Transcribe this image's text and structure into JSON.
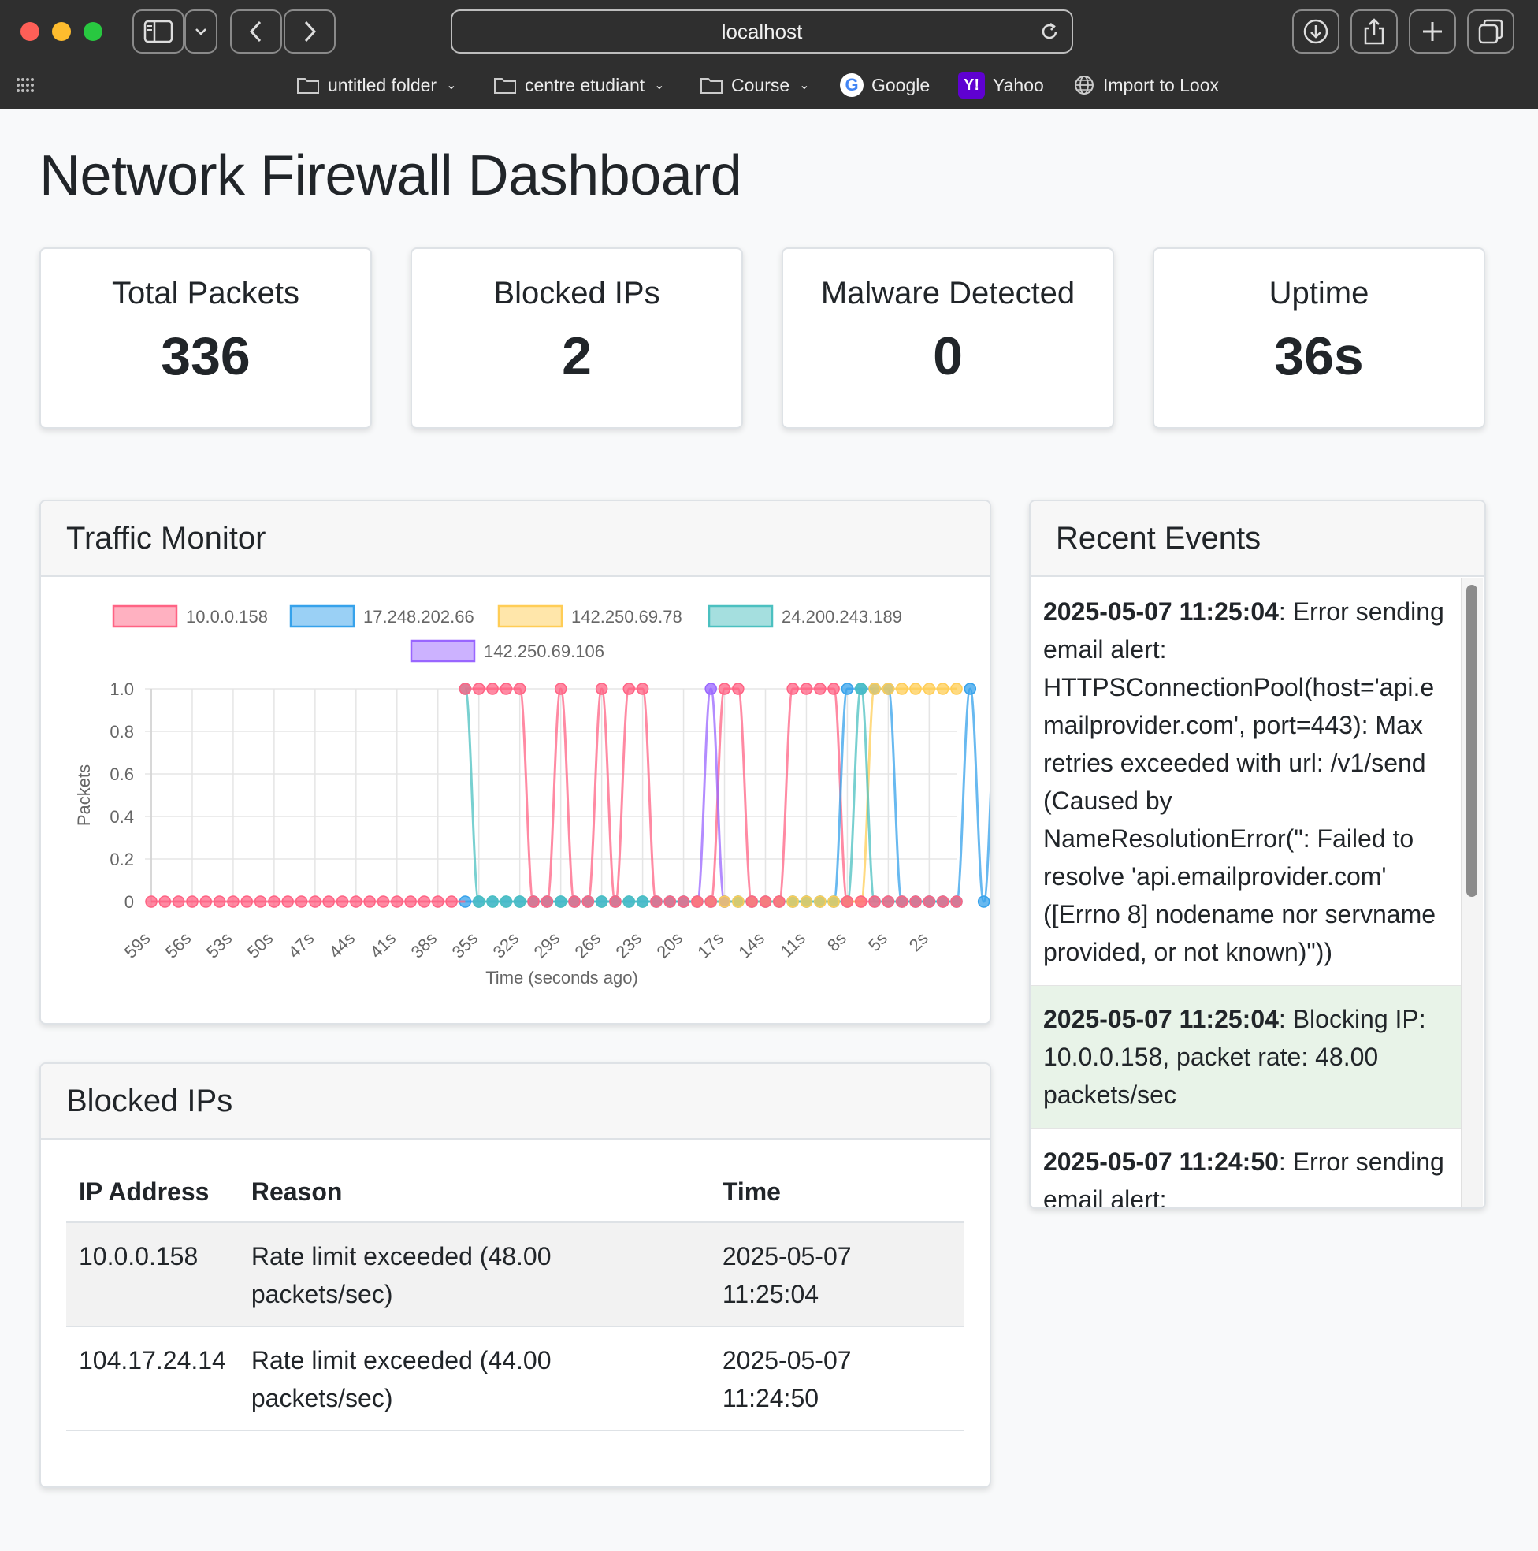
{
  "browser": {
    "url": "localhost",
    "bookmarks": [
      {
        "label": "untitled folder",
        "icon": "folder-icon"
      },
      {
        "label": "centre etudiant",
        "icon": "folder-icon"
      },
      {
        "label": "Course",
        "icon": "folder-icon"
      },
      {
        "label": "Google",
        "icon": "google-icon"
      },
      {
        "label": "Yahoo",
        "icon": "yahoo-icon"
      },
      {
        "label": "Import to Loox",
        "icon": "globe-icon"
      }
    ]
  },
  "page": {
    "title": "Network Firewall Dashboard"
  },
  "stats": [
    {
      "label": "Total Packets",
      "value": "336"
    },
    {
      "label": "Blocked IPs",
      "value": "2"
    },
    {
      "label": "Malware Detected",
      "value": "0"
    },
    {
      "label": "Uptime",
      "value": "36s"
    }
  ],
  "traffic": {
    "title": "Traffic Monitor"
  },
  "chart_data": {
    "type": "line",
    "xlabel": "Time (seconds ago)",
    "ylabel": "Packets",
    "ylim": [
      0,
      1
    ],
    "yticks": [
      "0",
      "0.2",
      "0.4",
      "0.6",
      "0.8",
      "1.0"
    ],
    "x": [
      "59s",
      "58s",
      "57s",
      "56s",
      "55s",
      "54s",
      "53s",
      "52s",
      "51s",
      "50s",
      "49s",
      "48s",
      "47s",
      "46s",
      "45s",
      "44s",
      "43s",
      "42s",
      "41s",
      "40s",
      "39s",
      "38s",
      "37s",
      "36s",
      "35s",
      "34s",
      "33s",
      "32s",
      "31s",
      "30s",
      "29s",
      "28s",
      "27s",
      "26s",
      "25s",
      "24s",
      "23s",
      "22s",
      "21s",
      "20s",
      "19s",
      "18s",
      "17s",
      "16s",
      "15s",
      "14s",
      "13s",
      "12s",
      "11s",
      "10s",
      "9s",
      "8s",
      "7s",
      "6s",
      "5s",
      "4s",
      "3s",
      "2s",
      "1s",
      "0s"
    ],
    "xticks_shown": [
      "59s",
      "56s",
      "53s",
      "50s",
      "47s",
      "44s",
      "41s",
      "38s",
      "35s",
      "32s",
      "29s",
      "26s",
      "23s",
      "20s",
      "17s",
      "14s",
      "11s",
      "8s",
      "5s",
      "2s"
    ],
    "legend_position": "top",
    "grid": true,
    "series": [
      {
        "name": "10.0.0.158",
        "color": "#ff6384",
        "start": 23,
        "values": [
          1,
          1,
          1,
          1,
          1,
          0,
          0,
          1,
          0,
          0,
          1,
          0,
          1,
          1,
          0,
          0,
          0,
          0,
          0,
          1,
          1,
          0,
          0,
          0,
          1,
          1,
          1,
          1,
          0,
          0,
          0,
          0,
          0,
          0,
          0,
          0,
          0
        ]
      },
      {
        "name": "17.248.202.66",
        "color": "#36a2eb",
        "start": 23,
        "values": [
          0,
          0,
          0,
          0,
          0,
          0,
          0,
          0,
          0,
          0,
          0,
          0,
          0,
          0,
          0,
          0,
          0,
          0,
          0,
          0,
          0,
          0,
          0,
          0,
          0,
          0,
          0,
          0,
          1,
          1,
          1,
          1,
          0,
          0,
          0,
          0,
          0,
          1,
          0,
          1,
          0,
          0,
          0,
          0,
          0
        ]
      },
      {
        "name": "142.250.69.78",
        "color": "#ffcd56",
        "start": 40,
        "values": [
          0,
          0,
          0,
          0,
          0,
          0,
          0,
          0,
          0,
          0,
          0,
          0,
          0,
          1,
          1,
          1,
          1,
          1,
          1,
          1
        ]
      },
      {
        "name": "24.200.243.189",
        "color": "#4bc0c0",
        "start": 23,
        "values": [
          1,
          0,
          0,
          0,
          0,
          0,
          0,
          0,
          0,
          0,
          0,
          0,
          0,
          0,
          0,
          0,
          0,
          0,
          0,
          0,
          0,
          0,
          0,
          0,
          0,
          0,
          0,
          0,
          0,
          1,
          0,
          0,
          0,
          0,
          0,
          0,
          0
        ]
      },
      {
        "name": "142.250.69.106",
        "color": "#9966ff",
        "start": 40,
        "values": [
          0,
          1,
          0
        ]
      }
    ]
  },
  "events": {
    "title": "Recent Events",
    "items": [
      {
        "time": "2025-05-07 11:25:04",
        "message": ": Error sending email alert: HTTPSConnectionPool(host='api.emailprovider.com', port=443): Max retries exceeded with url: /v1/send (Caused by NameResolutionError(\": Failed to resolve 'api.emailprovider.com' ([Errno 8] nodename nor servname provided, or not known)\"))",
        "type": "error"
      },
      {
        "time": "2025-05-07 11:25:04",
        "message": ": Blocking IP: 10.0.0.158, packet rate: 48.00 packets/sec",
        "type": "success"
      },
      {
        "time": "2025-05-07 11:24:50",
        "message": ": Error sending email alert:",
        "type": "error"
      }
    ]
  },
  "blocked": {
    "title": "Blocked IPs",
    "headers": {
      "ip": "IP Address",
      "reason": "Reason",
      "time": "Time"
    },
    "rows": [
      {
        "ip": "10.0.0.158",
        "reason": "Rate limit exceeded (48.00 packets/sec)",
        "time": "2025-05-07 11:25:04"
      },
      {
        "ip": "104.17.24.14",
        "reason": "Rate limit exceeded (44.00 packets/sec)",
        "time": "2025-05-07 11:24:50"
      }
    ]
  }
}
